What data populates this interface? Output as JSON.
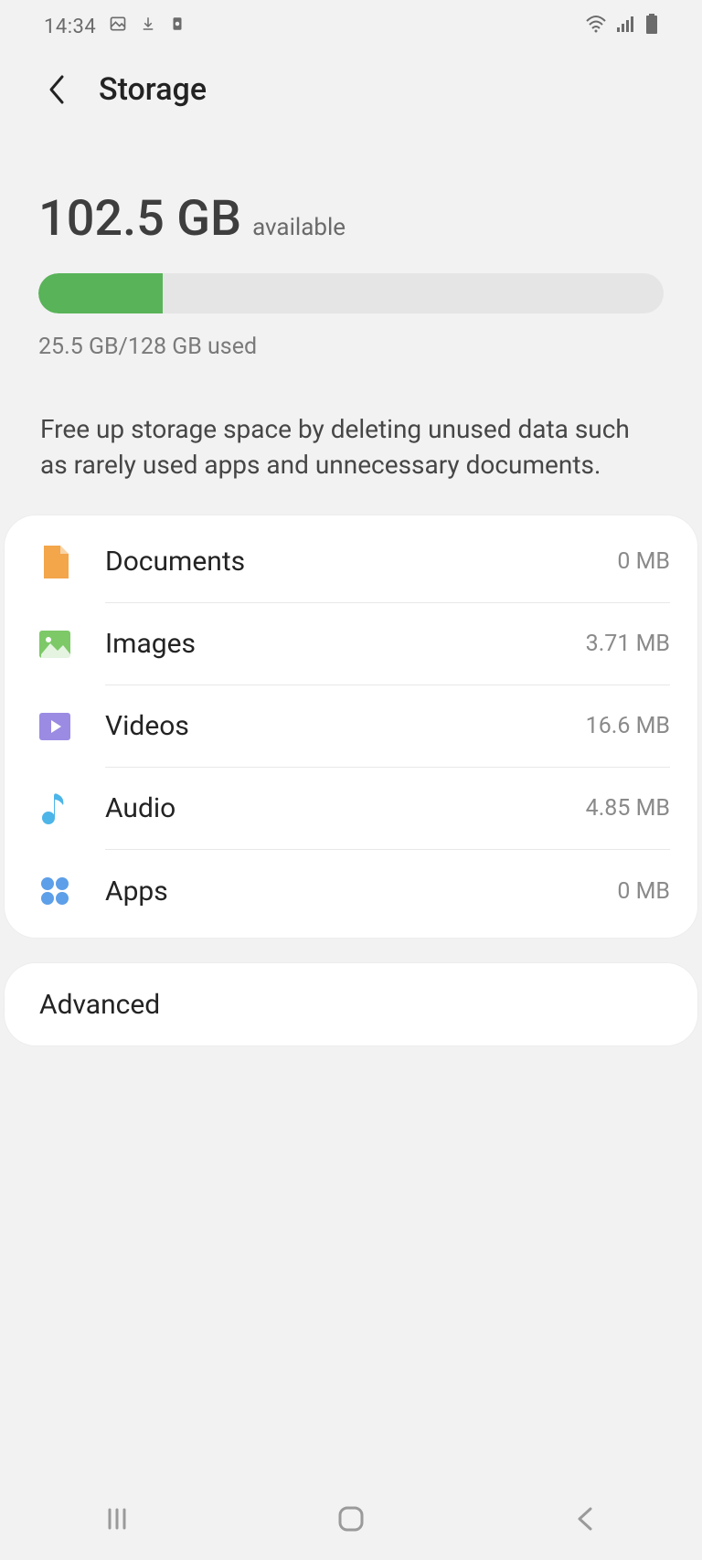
{
  "statusBar": {
    "time": "14:34"
  },
  "header": {
    "title": "Storage"
  },
  "summary": {
    "available": "102.5 GB",
    "availableLabel": "available",
    "usageText": "25.5 GB/128 GB used",
    "usedPercent": 19.9
  },
  "description": "Free up storage space by deleting unused data such as rarely used apps and unnecessary documents.",
  "categories": [
    {
      "label": "Documents",
      "size": "0 MB",
      "icon": "documents",
      "color": "#f3a64a"
    },
    {
      "label": "Images",
      "size": "3.71 MB",
      "icon": "images",
      "color": "#7dc968"
    },
    {
      "label": "Videos",
      "size": "16.6 MB",
      "icon": "videos",
      "color": "#9b8be3"
    },
    {
      "label": "Audio",
      "size": "4.85 MB",
      "icon": "audio",
      "color": "#4db5e8"
    },
    {
      "label": "Apps",
      "size": "0 MB",
      "icon": "apps",
      "color": "#5d9fe8"
    }
  ],
  "advanced": {
    "label": "Advanced"
  }
}
